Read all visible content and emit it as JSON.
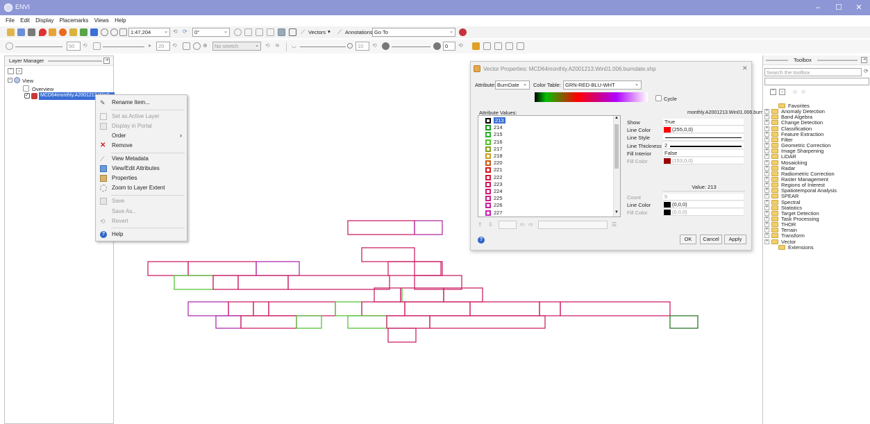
{
  "window": {
    "title": "ENVI",
    "minimize": "–",
    "maximize": "☐",
    "close": "✕"
  },
  "menubar": [
    "File",
    "Edit",
    "Display",
    "Placemarks",
    "Views",
    "Help"
  ],
  "toolbar1": {
    "scale": "1:47,204",
    "rotation": "0°",
    "vectors_label": "Vectors",
    "annotations_label": "Annotations",
    "goto_value": "Go To"
  },
  "toolbar2": {
    "brightness": "50",
    "contrast": "20",
    "stretch": "No stretch",
    "sharpen": "10",
    "transparency": "0"
  },
  "layer_manager": {
    "title": "Layer Manager",
    "root": "View",
    "overview": "Overview",
    "layer": "MCD64monthly.A2001213.Win0"
  },
  "context_menu": {
    "items": [
      {
        "label": "Rename Item...",
        "enabled": true
      },
      {
        "label": "Set as Active Layer",
        "enabled": false
      },
      {
        "label": "Display in Portal",
        "enabled": false
      },
      {
        "label": "Order",
        "enabled": true,
        "submenu": true
      },
      {
        "label": "Remove",
        "enabled": true
      },
      {
        "label": "View Metadata",
        "enabled": true
      },
      {
        "label": "View/Edit Attributes",
        "enabled": true
      },
      {
        "label": "Properties",
        "enabled": true
      },
      {
        "label": "Zoom to Layer Extent",
        "enabled": true
      },
      {
        "label": "Save",
        "enabled": false
      },
      {
        "label": "Save As...",
        "enabled": false
      },
      {
        "label": "Revert",
        "enabled": false
      },
      {
        "label": "Help",
        "enabled": true
      }
    ],
    "submenu_arrow": "›"
  },
  "dialog": {
    "title": "Vector Properties: MCD64monthly.A2001213.Win01.006.burndate.shp",
    "attribute_label": "Attribute:",
    "attribute_value": "BurnDate",
    "color_table_label": "Color Table:",
    "color_table_value": "GRN-RED-BLU-WHT",
    "cycle_label": "Cycle",
    "attribute_values_label": "Attribute Values:",
    "values": [
      {
        "v": "213",
        "color": "#000000"
      },
      {
        "v": "214",
        "color": "#1a9a1a"
      },
      {
        "v": "215",
        "color": "#2bb02b"
      },
      {
        "v": "216",
        "color": "#4fc12a"
      },
      {
        "v": "217",
        "color": "#7f9f20"
      },
      {
        "v": "218",
        "color": "#c8a018"
      },
      {
        "v": "220",
        "color": "#c85a10"
      },
      {
        "v": "221",
        "color": "#d01818"
      },
      {
        "v": "222",
        "color": "#d2183a"
      },
      {
        "v": "223",
        "color": "#d01a5a"
      },
      {
        "v": "224",
        "color": "#cf1b73"
      },
      {
        "v": "225",
        "color": "#cc1d8a"
      },
      {
        "v": "226",
        "color": "#c81fa0"
      },
      {
        "v": "227",
        "color": "#c221b4"
      }
    ],
    "layer_header": "monthly.A2001213.Win01.006.burnd",
    "props": [
      {
        "k": "Show",
        "v": "True"
      },
      {
        "k": "Line Color",
        "v": "(255,0,0)",
        "swatch": "#ff0000"
      },
      {
        "k": "Line Style",
        "v": ""
      },
      {
        "k": "Line Thickness",
        "v": "2"
      },
      {
        "k": "Fill Interior",
        "v": "False"
      },
      {
        "k": "Fill Color",
        "v": "(153,0,0)",
        "swatch": "#990000"
      }
    ],
    "value_header": "Value: 213",
    "value_props": [
      {
        "k": "Count",
        "v": "5"
      },
      {
        "k": "Line Color",
        "v": "(0,0,0)",
        "swatch": "#000000"
      },
      {
        "k": "Fill Color",
        "v": "(0,0,0)",
        "swatch": "#000000"
      }
    ],
    "buttons": {
      "ok": "OK",
      "cancel": "Cancel",
      "apply": "Apply"
    },
    "help": "?",
    "close": "✕"
  },
  "toolbox": {
    "title": "Toolbox",
    "search_placeholder": "Search the toolbox",
    "items": [
      "Favorites",
      "Anomaly Detection",
      "Band Algebra",
      "Change Detection",
      "Classification",
      "Feature Extraction",
      "Filter",
      "Geometric Correction",
      "Image Sharpening",
      "LiDAR",
      "Mosaicking",
      "Radar",
      "Radiometric Correction",
      "Raster Management",
      "Regions of Interest",
      "Spatiotemporal Analysis",
      "SPEAR",
      "Spectral",
      "Statistics",
      "Target Detection",
      "Task Processing",
      "THOR",
      "Terrain",
      "Transform",
      "Vector",
      "Extensions"
    ]
  },
  "colors": {
    "titlebar": "#8e97d6",
    "selection": "#3b6fd6",
    "accent_red": "#d32020"
  }
}
